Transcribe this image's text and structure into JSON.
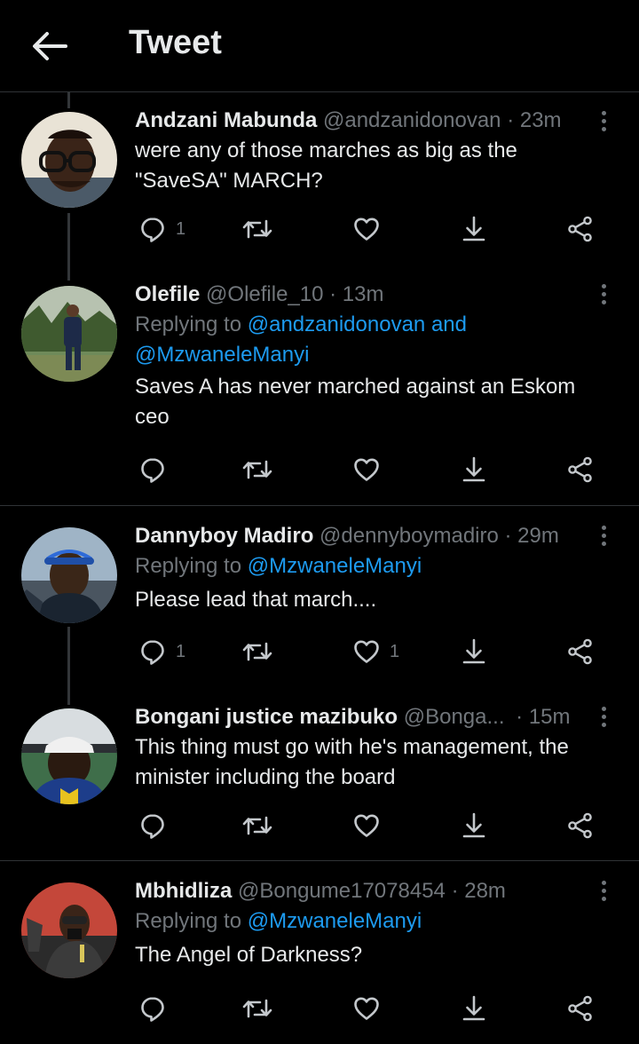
{
  "header": {
    "title": "Tweet"
  },
  "reply_count_1": "1",
  "tweets": [
    {
      "name": "Andzani Mabunda",
      "handle": "@andzanidonovan",
      "time": "· 23m",
      "text_line1": "were any of those marches as big as the",
      "text_line2": "\"SaveSA\" MARCH?",
      "reply_count": "1",
      "like_count": ""
    },
    {
      "name": "Olefile",
      "handle": "@Olefile_10",
      "time": "· 13m",
      "replying_prefix": "Replying to",
      "replying_links_1": "@andzanidonovan and",
      "replying_links_2": "@MzwaneleManyi",
      "text_line1": "Saves A has never marched against an Eskom",
      "text_line2": "ceo",
      "reply_count": "",
      "like_count": ""
    },
    {
      "name": "Dannyboy Madiro",
      "handle": "@dennyboymadiro",
      "time": "· 29m",
      "replying_prefix": "Replying to",
      "replying_links_1": "@MzwaneleManyi",
      "text_line1": "Please lead that march....",
      "reply_count": "1",
      "like_count": "1"
    },
    {
      "name": "Bongani justice mazibuko",
      "handle": "@Bonga...",
      "time": "· 15m",
      "text_line1": "This thing must go with he's management, the",
      "text_line2": "minister including the board",
      "reply_count": "",
      "like_count": ""
    },
    {
      "name": "Mbhidliza",
      "handle": "@Bongume17078454",
      "time": "· 28m",
      "replying_prefix": "Replying to",
      "replying_links_1": "@MzwaneleManyi",
      "text_line1": "The Angel of Darkness?",
      "reply_count": "",
      "like_count": ""
    }
  ],
  "icons": {
    "back": "arrow-left-icon",
    "more": "more-vertical-icon",
    "reply": "reply-icon",
    "retweet": "retweet-icon",
    "like": "heart-icon",
    "download": "download-icon",
    "share": "share-icon"
  },
  "colors": {
    "background": "#000000",
    "text": "#e7e9ea",
    "muted": "#71767b",
    "link": "#1d9bf0",
    "divider": "#2f3336"
  }
}
